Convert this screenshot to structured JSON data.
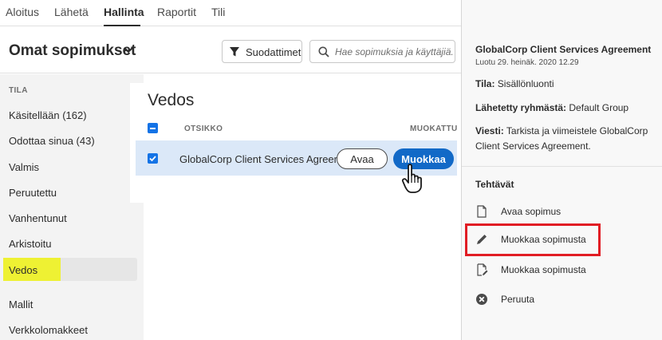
{
  "topnav": {
    "tabs": [
      {
        "label": "Aloitus"
      },
      {
        "label": "Lähetä"
      },
      {
        "label": "Hallinta"
      },
      {
        "label": "Raportit"
      },
      {
        "label": "Tili"
      }
    ],
    "active_tab": "Hallinta"
  },
  "header": {
    "title": "Omat sopimukset",
    "filters_label": "Suodattimet",
    "search_placeholder": "Hae sopimuksia ja käyttäjiä..."
  },
  "sidebar": {
    "heading": "TILA",
    "items": [
      {
        "label": "Käsitellään (162)"
      },
      {
        "label": "Odottaa sinua (43)"
      },
      {
        "label": "Valmis"
      },
      {
        "label": "Peruutettu"
      },
      {
        "label": "Vanhentunut"
      },
      {
        "label": "Arkistoitu"
      },
      {
        "label": "Vedos"
      },
      {
        "label": "Mallit"
      },
      {
        "label": "Verkkolomakkeet"
      }
    ],
    "selected": "Vedos"
  },
  "main": {
    "title": "Vedos",
    "col_title": "OTSIKKO",
    "col_edited": "MUOKATTU",
    "rows": [
      {
        "title": "GlobalCorp Client Services Agreement",
        "open_label": "Avaa",
        "edit_label": "Muokkaa"
      }
    ]
  },
  "details": {
    "agreement_title": "GlobalCorp Client Services Agreement",
    "created": "Luotu 29. heinäk. 2020 12.29",
    "status_label": "Tila:",
    "status_value": "Sisällönluonti",
    "group_label": "Lähetetty ryhmästä:",
    "group_value": "Default Group",
    "message_label": "Viesti:",
    "message_value": "Tarkista ja viimeistele GlobalCorp Client Services Agreement.",
    "tasks_heading": "Tehtävät",
    "tasks": [
      {
        "label": "Avaa sopimus",
        "icon": "document-icon"
      },
      {
        "label": "Muokkaa sopimusta",
        "icon": "pencil-icon"
      },
      {
        "label": "Muokkaa sopimusta",
        "icon": "document-edit-icon"
      },
      {
        "label": "Peruuta",
        "icon": "cancel-circle-icon"
      }
    ]
  },
  "colors": {
    "accent_blue": "#1269c7",
    "highlight_yellow": "#eef133",
    "callout_red": "#e11d24",
    "row_selected": "#dbe8f8"
  }
}
